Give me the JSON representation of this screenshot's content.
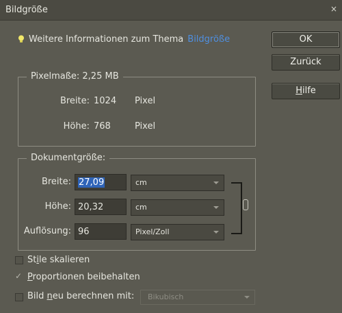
{
  "window": {
    "title": "Bildgröße",
    "close_label": "×"
  },
  "info": {
    "text": "Weitere Informationen zum Thema",
    "link": "Bildgröße"
  },
  "buttons": {
    "ok": "OK",
    "back": "Zurück",
    "help_underlined": "H",
    "help_rest": "ilfe"
  },
  "pixel_dims": {
    "legend": "Pixelmaße: 2,25 MB",
    "width_label": "Breite:",
    "width_value": "1024",
    "width_unit": "Pixel",
    "height_label": "Höhe:",
    "height_value": "768",
    "height_unit": "Pixel"
  },
  "doc_size": {
    "legend": "Dokumentgröße:",
    "width_label": "Breite:",
    "width_value": "27,09",
    "width_unit": "cm",
    "height_label": "Höhe:",
    "height_value": "20,32",
    "height_unit": "cm",
    "res_label": "Auflösung:",
    "res_value": "96",
    "res_unit": "Pixel/Zoll"
  },
  "options": {
    "scale_styles": {
      "label_pre": "St",
      "label_u": "i",
      "label_post": "le skalieren",
      "checked": false
    },
    "constrain": {
      "label_u": "P",
      "label_post": "roportionen beibehalten",
      "checked": true
    },
    "resample": {
      "label_pre": "Bild ",
      "label_u": "n",
      "label_post": "eu berechnen mit:",
      "checked": false,
      "method": "Bikubisch"
    }
  },
  "colors": {
    "background": "#5b5a51",
    "link": "#4f8fe0",
    "selection": "#2f64b8"
  }
}
